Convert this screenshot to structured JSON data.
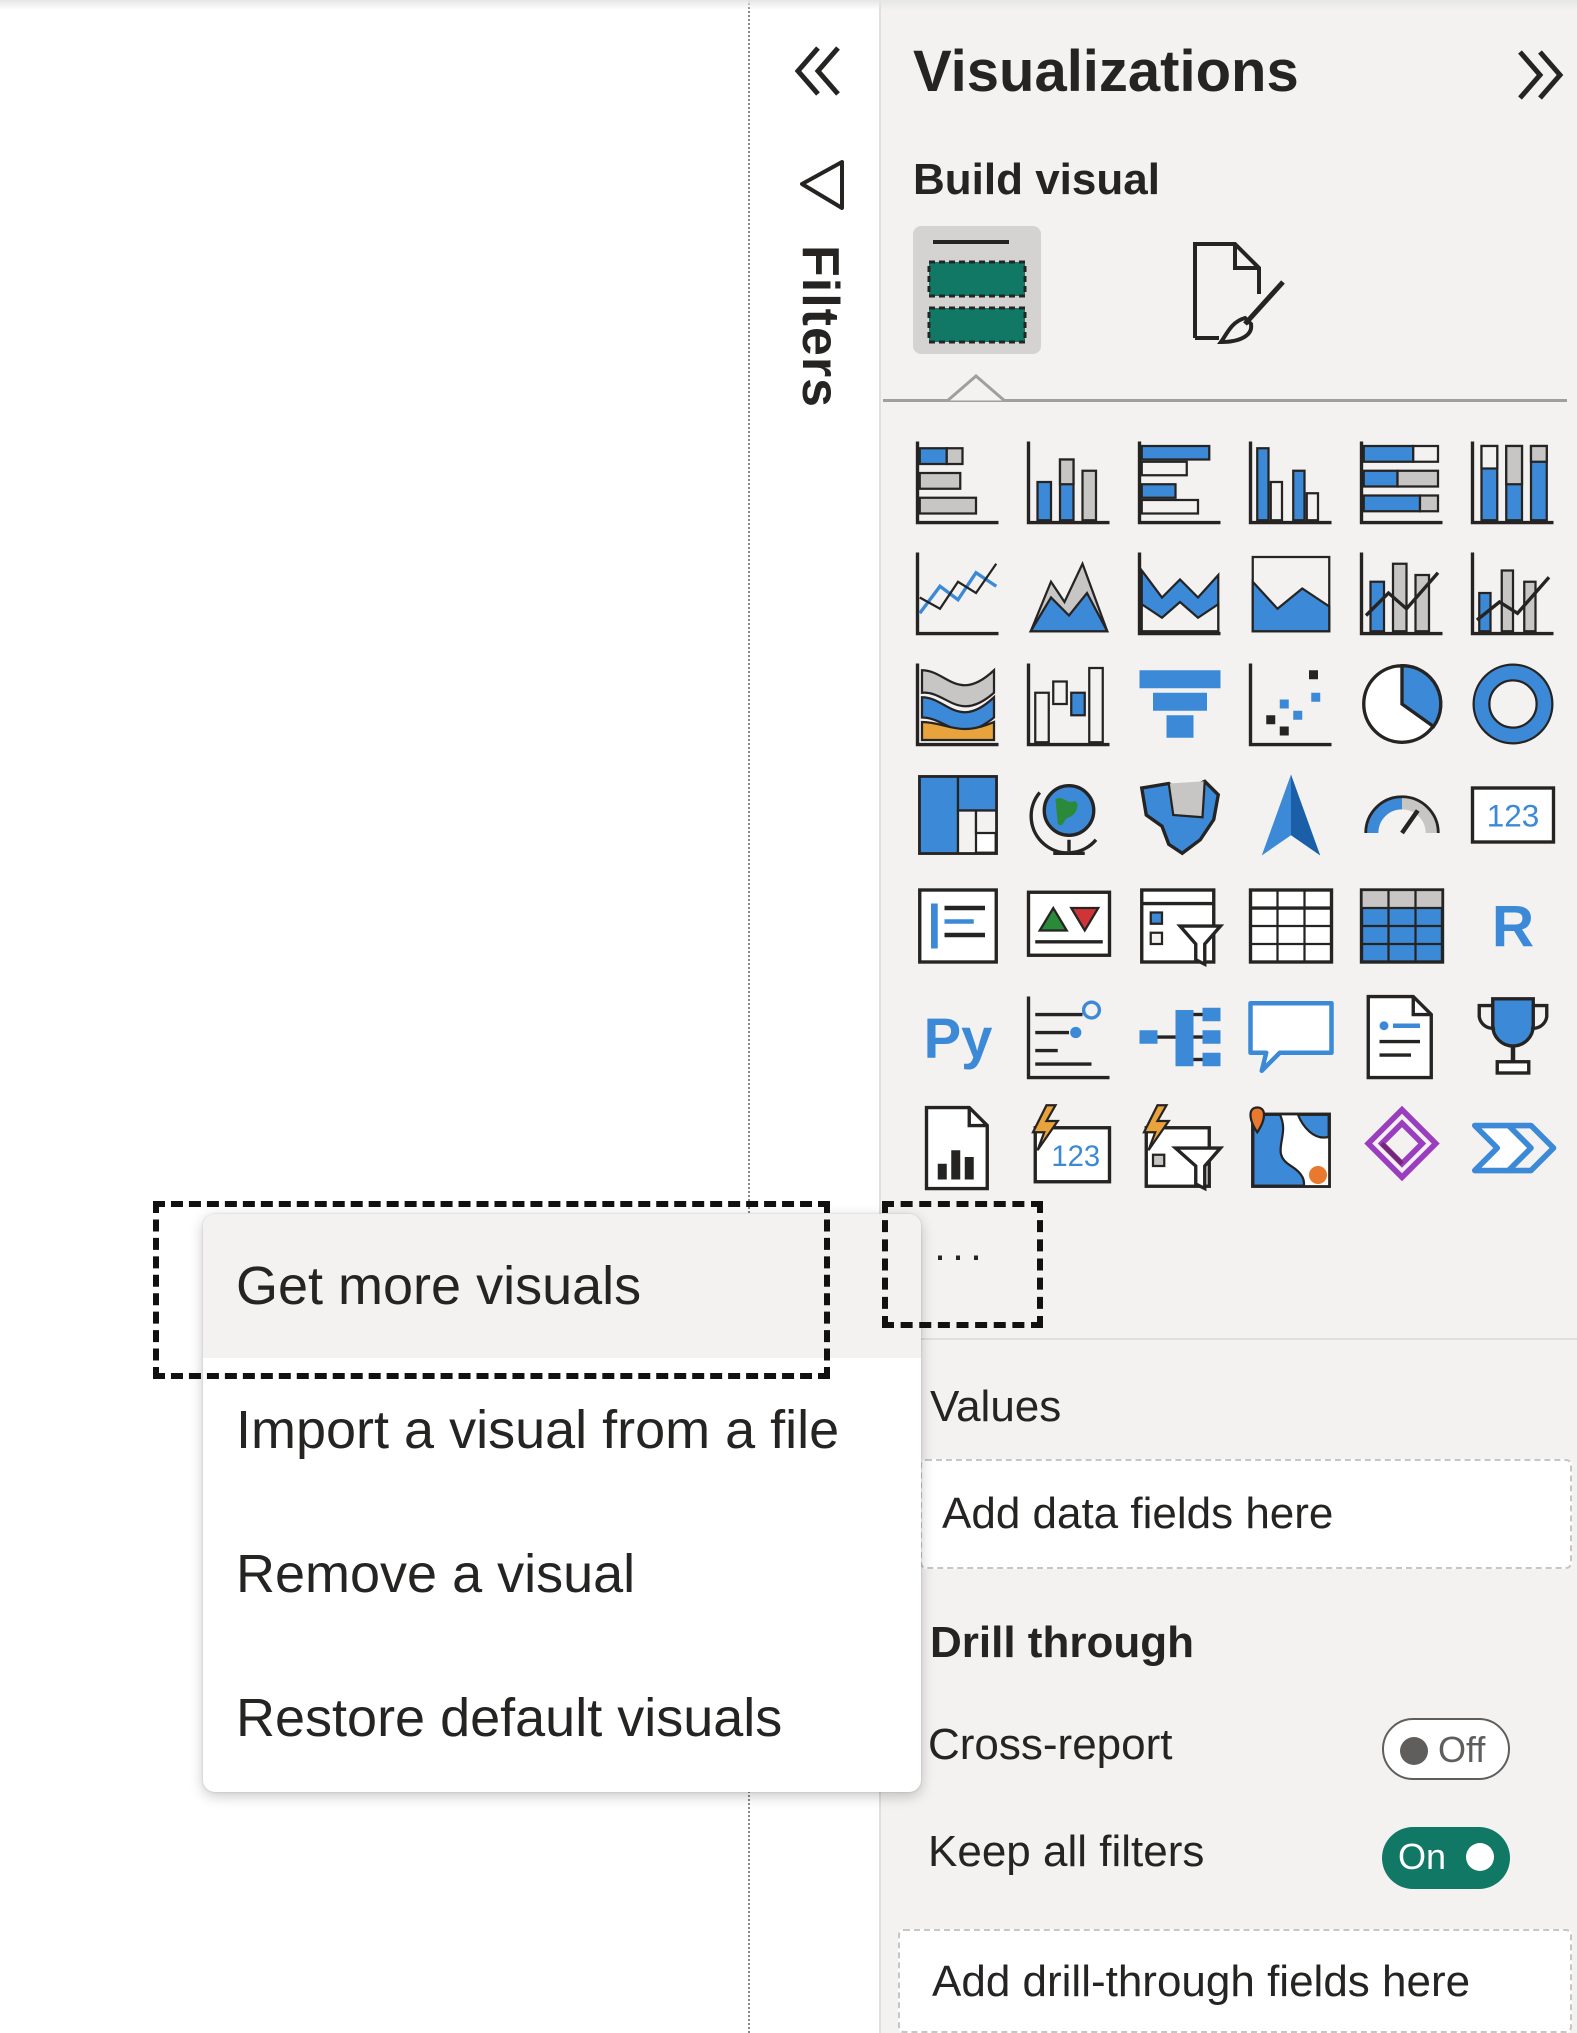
{
  "filters": {
    "label": "Filters"
  },
  "visualizations": {
    "title": "Visualizations",
    "build_visual_label": "Build visual",
    "icons": [
      "stacked-bar-chart-icon",
      "stacked-column-chart-icon",
      "clustered-bar-chart-icon",
      "clustered-column-chart-icon",
      "100-stacked-bar-chart-icon",
      "100-stacked-column-chart-icon",
      "line-chart-icon",
      "area-chart-icon",
      "stacked-area-chart-icon",
      "100-stacked-area-chart-icon",
      "line-and-stacked-column-chart-icon",
      "line-and-clustered-column-chart-icon",
      "ribbon-chart-icon",
      "waterfall-chart-icon",
      "funnel-chart-icon",
      "scatter-chart-icon",
      "pie-chart-icon",
      "donut-chart-icon",
      "treemap-icon",
      "map-icon",
      "filled-map-icon",
      "azure-map-icon",
      "gauge-icon",
      "card-icon",
      "multi-row-card-icon",
      "kpi-icon",
      "slicer-icon",
      "table-icon",
      "matrix-icon",
      "r-script-visual-icon",
      "python-visual-icon",
      "key-influencers-icon",
      "decomposition-tree-icon",
      "qa-icon",
      "smart-narrative-icon",
      "metrics-icon",
      "paginated-report-icon",
      "power-apps-card-icon",
      "power-apps-slicer-icon",
      "arcgis-map-icon",
      "power-apps-icon",
      "power-automate-icon"
    ],
    "more_button": "···",
    "values_label": "Values",
    "values_placeholder": "Add data fields here",
    "drill_through_label": "Drill through",
    "cross_report_label": "Cross-report",
    "cross_report_toggle": "Off",
    "keep_filters_label": "Keep all filters",
    "keep_filters_toggle": "On",
    "drill_placeholder": "Add drill-through fields here"
  },
  "context_menu": {
    "items": [
      "Get more visuals",
      "Import a visual from a file",
      "Remove a visual",
      "Restore default visuals"
    ]
  },
  "colors": {
    "accent_teal": "#117865",
    "icon_blue": "#3c8ad7",
    "pane_background": "#f3f2f1"
  }
}
